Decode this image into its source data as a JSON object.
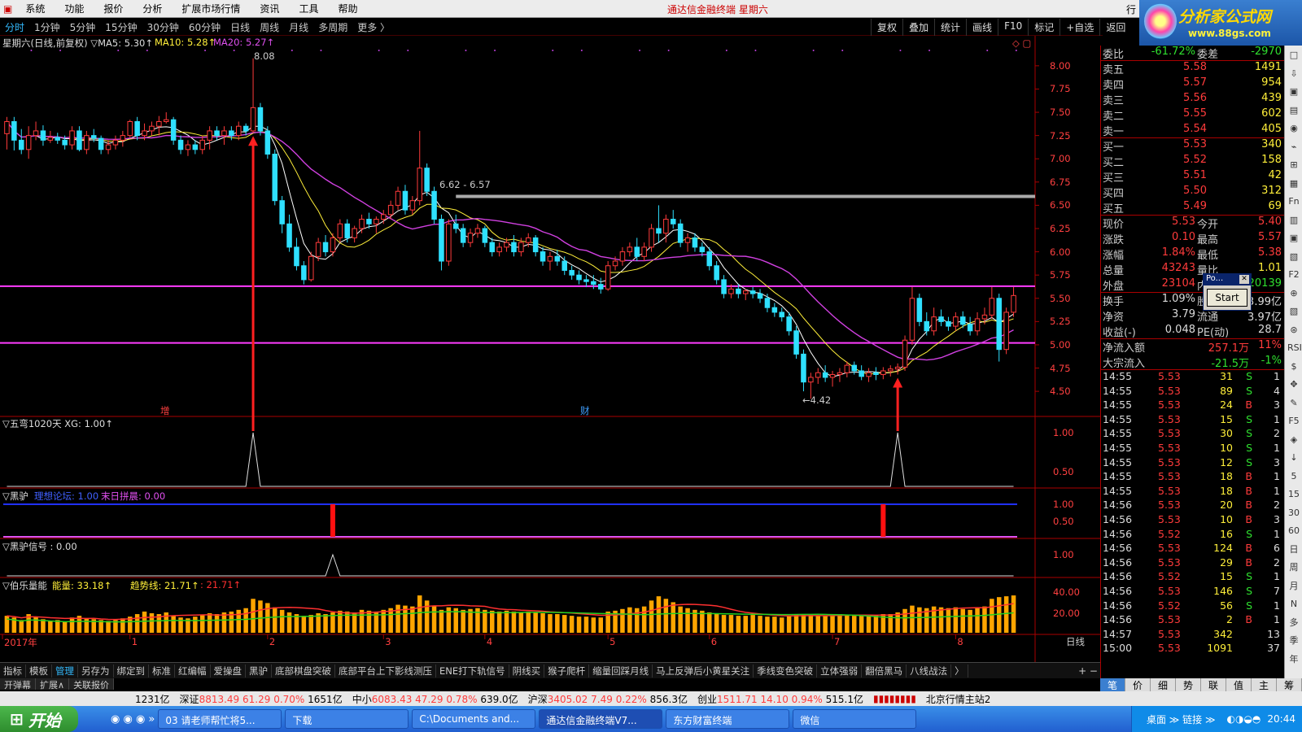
{
  "menu": [
    "系统",
    "功能",
    "报价",
    "分析",
    "扩展市场行情",
    "资讯",
    "工具",
    "帮助"
  ],
  "window_title": "通达信金融终端 星期六",
  "logo": {
    "cn": "分析家公式网",
    "url": "www.88gs.com"
  },
  "periods": [
    "分时",
    "1分钟",
    "5分钟",
    "15分钟",
    "30分钟",
    "60分钟",
    "日线",
    "周线",
    "月线",
    "多周期",
    "更多 〉"
  ],
  "active_period": "分时",
  "right_tools": [
    "复权",
    "叠加",
    "统计",
    "画线",
    "F10",
    "标记",
    "+自选",
    "返回"
  ],
  "header_right": "行",
  "main_title": "星期六(日线,前复权) ▽MA5: 5.30↑",
  "ma10": "MA10: 5.28↑",
  "ma20": "MA20: 5.27↑",
  "price_ticks": [
    "8.00",
    "7.75",
    "7.50",
    "7.25",
    "7.00",
    "6.75",
    "6.50",
    "6.25",
    "6.00",
    "5.75",
    "5.50",
    "5.25",
    "5.00",
    "4.75",
    "4.50"
  ],
  "annotations": {
    "high": "8.08",
    "box": "6.62 - 6.57",
    "low": "←4.42",
    "zeng": "增",
    "cai": "财"
  },
  "x_labels": [
    "2017年",
    "1",
    "2",
    "3",
    "4",
    "5",
    "6",
    "7",
    "8"
  ],
  "x_right": "日线",
  "panel1": {
    "title": "▽五弯1020天 XG: 1.00↑",
    "ticks": [
      "1.00",
      "0.50"
    ]
  },
  "panel2": {
    "title": "▽黑驴",
    "t2": "理想论坛: 1.00",
    "t3": "末日拼晨: 0.00",
    "ticks": [
      "1.00",
      "0.50"
    ]
  },
  "panel3": {
    "title": "▽黑驴信号 : 0.00",
    "ticks": [
      "1.00"
    ]
  },
  "panel4": {
    "title": "▽伯乐量能",
    "t2": "能量: 33.18↑",
    "t3": "趋势线: 21.71↑",
    "t4": ": 21.71↑",
    "ticks": [
      "40.00",
      "20.00"
    ]
  },
  "indicators": [
    "指标",
    "模板",
    "管理",
    "另存为",
    "绑定到",
    "标准",
    "红编幅",
    "爱操盘",
    "黑驴",
    "底部棋盘突破",
    "底部平台上下影线测压",
    "ENE打下轨信号",
    "阴线买",
    "猴子爬杆",
    "缩量回踩月线",
    "马上反弹后小黄星关注",
    "季线变色突破",
    "立体强弱",
    "翻倍黑马",
    "八线战法",
    "〉"
  ],
  "active_indicator": "管理",
  "extra_tabs": [
    "开弹幕",
    "扩展∧",
    "关联报价"
  ],
  "side": {
    "weibi": {
      "n": "委比",
      "p": "-61.72%",
      "n2": "委差",
      "v": "-2970"
    },
    "asks": [
      [
        "卖五",
        "5.58",
        "1491"
      ],
      [
        "卖四",
        "5.57",
        "954"
      ],
      [
        "卖三",
        "5.56",
        "439"
      ],
      [
        "卖二",
        "5.55",
        "602"
      ],
      [
        "卖一",
        "5.54",
        "405"
      ]
    ],
    "bids": [
      [
        "买一",
        "5.53",
        "340"
      ],
      [
        "买二",
        "5.52",
        "158"
      ],
      [
        "买三",
        "5.51",
        "42"
      ],
      [
        "买四",
        "5.50",
        "312"
      ],
      [
        "买五",
        "5.49",
        "69"
      ]
    ],
    "stats": [
      [
        "现价",
        "5.53",
        "今开",
        "5.40"
      ],
      [
        "涨跌",
        "0.10",
        "最高",
        "5.57"
      ],
      [
        "涨幅",
        "1.84%",
        "最低",
        "5.38"
      ],
      [
        "总量",
        "43243",
        "量比",
        "1.01"
      ],
      [
        "外盘",
        "23104",
        "内盘",
        "20139"
      ]
    ],
    "stats2": [
      [
        "换手",
        "1.09%",
        "股本",
        "3.99亿"
      ],
      [
        "净资",
        "3.79",
        "流通",
        "3.97亿"
      ],
      [
        "收益(-)",
        "0.048",
        "PE(动)",
        "28.7"
      ]
    ],
    "flow": [
      [
        "净流入额",
        "257.1万",
        "11%"
      ],
      [
        "大宗流入",
        "-21.5万",
        "-1%"
      ]
    ],
    "ticks": [
      [
        "14:55",
        "5.53",
        "31",
        "S",
        "1"
      ],
      [
        "14:55",
        "5.53",
        "89",
        "S",
        "4"
      ],
      [
        "14:55",
        "5.53",
        "24",
        "B",
        "3"
      ],
      [
        "14:55",
        "5.53",
        "15",
        "S",
        "1"
      ],
      [
        "14:55",
        "5.53",
        "30",
        "S",
        "2"
      ],
      [
        "14:55",
        "5.53",
        "10",
        "S",
        "1"
      ],
      [
        "14:55",
        "5.53",
        "12",
        "S",
        "3"
      ],
      [
        "14:55",
        "5.53",
        "18",
        "B",
        "1"
      ],
      [
        "14:55",
        "5.53",
        "18",
        "B",
        "1"
      ],
      [
        "14:56",
        "5.53",
        "20",
        "B",
        "2"
      ],
      [
        "14:56",
        "5.53",
        "10",
        "B",
        "3"
      ],
      [
        "14:56",
        "5.52",
        "16",
        "S",
        "1"
      ],
      [
        "14:56",
        "5.53",
        "124",
        "B",
        "6"
      ],
      [
        "14:56",
        "5.53",
        "29",
        "B",
        "2"
      ],
      [
        "14:56",
        "5.52",
        "15",
        "S",
        "1"
      ],
      [
        "14:56",
        "5.53",
        "146",
        "S",
        "7"
      ],
      [
        "14:56",
        "5.52",
        "56",
        "S",
        "1"
      ],
      [
        "14:56",
        "5.53",
        "2",
        "B",
        "1"
      ],
      [
        "14:57",
        "5.53",
        "342",
        "",
        "13"
      ],
      [
        "15:00",
        "5.53",
        "1091",
        "",
        "37"
      ]
    ]
  },
  "side_tabs": [
    "笔",
    "价",
    "细",
    "势",
    "联",
    "值",
    "主",
    "筹"
  ],
  "active_side_tab": "笔",
  "vtools": [
    "□",
    "⇩",
    "▣",
    "▤",
    "◉",
    "⌁",
    "⊞",
    "▦",
    "Fn",
    "▥",
    "▣",
    "▧",
    "F2",
    "⊕",
    "▧",
    "⊛",
    "RSI",
    "$",
    "✥",
    "✎",
    "F5",
    "◈",
    "↓",
    "5",
    "15",
    "30",
    "60",
    "日",
    "周",
    "月",
    "N",
    "多",
    "季",
    "年"
  ],
  "status": {
    "s1": "1231亿",
    "szname": "深证",
    "szv": "8813.49",
    "szc": "61.29",
    "szp": "0.70%",
    "szvol": "1651亿",
    "zxname": "中小",
    "zxv": "6083.43",
    "zxc": "47.29",
    "zxp": "0.78%",
    "zxvol": "639.0亿",
    "hsname": "沪深",
    "hsv": "3405.02",
    "hsc": "7.49",
    "hsp": "0.22%",
    "hsvol": "856.3亿",
    "cyname": "创业",
    "cyv": "1511.71",
    "cyc": "14.10",
    "cyp": "0.94%",
    "cyvol": "515.1亿",
    "server": "北京行情主站2"
  },
  "taskbar": {
    "start": "开始",
    "items": [
      "03 请老师帮忙将5...",
      "下载",
      "C:\\Documents and...",
      "通达信金融终端V7...",
      "东方财富终端",
      "微信"
    ],
    "active": "通达信金融终端V7...",
    "tray": "桌面 ≫ 链接 ≫",
    "time": "20:44"
  },
  "popup": {
    "title": "Po...",
    "button": "Start"
  },
  "colors": {
    "up": "#ff3b3b",
    "down": "#2fe0ff",
    "ma5": "#ffffff",
    "ma10": "#ffef3a",
    "ma20": "#d040e0",
    "hline": "#ff3cff",
    "box": "#aaaaaa",
    "arrow": "#ff2020",
    "vol": "#ffa500",
    "energy": "#ff3030",
    "trend": "#20d020"
  },
  "chart_data": {
    "type": "candlestick",
    "title": "星期六(日线,前复权)",
    "ylim": [
      4.3,
      8.2
    ],
    "x_months": [
      "2017年",
      "1",
      "2",
      "3",
      "4",
      "5",
      "6",
      "7",
      "8"
    ],
    "month_start_index": [
      0,
      17,
      36,
      52,
      66,
      83,
      97,
      114,
      131
    ],
    "annotations": {
      "high": 8.08,
      "low": 4.42,
      "box": [
        6.62,
        6.57
      ],
      "hlines": [
        5.63,
        5.02
      ]
    },
    "candles": [
      [
        7.27,
        7.45,
        7.1,
        7.4
      ],
      [
        7.4,
        7.45,
        7.09,
        7.2
      ],
      [
        7.2,
        7.32,
        7.05,
        7.1
      ],
      [
        7.1,
        7.35,
        7.0,
        7.25
      ],
      [
        7.25,
        7.4,
        7.2,
        7.3
      ],
      [
        7.3,
        7.36,
        7.14,
        7.2
      ],
      [
        7.2,
        7.3,
        7.17,
        7.23
      ],
      [
        7.23,
        7.28,
        7.16,
        7.2
      ],
      [
        7.2,
        7.25,
        7.1,
        7.15
      ],
      [
        7.15,
        7.35,
        7.1,
        7.3
      ],
      [
        7.3,
        7.35,
        7.08,
        7.1
      ],
      [
        7.1,
        7.3,
        7.05,
        7.25
      ],
      [
        7.25,
        7.32,
        7.18,
        7.22
      ],
      [
        7.22,
        7.25,
        7.05,
        7.1
      ],
      [
        7.1,
        7.2,
        7.05,
        7.15
      ],
      [
        7.15,
        7.25,
        7.1,
        7.2
      ],
      [
        7.2,
        7.3,
        7.13,
        7.25
      ],
      [
        7.25,
        7.42,
        7.23,
        7.4
      ],
      [
        7.4,
        7.45,
        7.2,
        7.25
      ],
      [
        7.25,
        7.38,
        7.2,
        7.3
      ],
      [
        7.3,
        7.4,
        7.25,
        7.35
      ],
      [
        7.35,
        7.46,
        7.25,
        7.4
      ],
      [
        7.4,
        7.5,
        7.38,
        7.42
      ],
      [
        7.42,
        7.45,
        7.15,
        7.2
      ],
      [
        7.2,
        7.25,
        7.05,
        7.1
      ],
      [
        7.1,
        7.2,
        7.03,
        7.15
      ],
      [
        7.15,
        7.2,
        7.05,
        7.1
      ],
      [
        7.1,
        7.25,
        7.05,
        7.2
      ],
      [
        7.2,
        7.35,
        7.1,
        7.3
      ],
      [
        7.3,
        7.35,
        7.2,
        7.25
      ],
      [
        7.25,
        7.35,
        7.15,
        7.3
      ],
      [
        7.3,
        7.35,
        7.2,
        7.25
      ],
      [
        7.25,
        7.4,
        7.2,
        7.35
      ],
      [
        7.35,
        7.38,
        7.25,
        7.3
      ],
      [
        7.3,
        8.08,
        7.28,
        7.55
      ],
      [
        7.55,
        7.6,
        7.25,
        7.3
      ],
      [
        7.3,
        7.35,
        7.0,
        7.05
      ],
      [
        7.05,
        7.1,
        6.5,
        6.55
      ],
      [
        6.55,
        6.6,
        6.2,
        6.3
      ],
      [
        6.3,
        6.4,
        6.0,
        6.05
      ],
      [
        6.05,
        6.15,
        5.8,
        5.85
      ],
      [
        5.85,
        5.9,
        5.65,
        5.7
      ],
      [
        5.7,
        6.0,
        5.68,
        5.95
      ],
      [
        5.95,
        6.15,
        5.9,
        6.1
      ],
      [
        6.1,
        6.18,
        5.95,
        6.0
      ],
      [
        6.0,
        6.2,
        5.95,
        6.15
      ],
      [
        6.15,
        6.35,
        6.1,
        6.3
      ],
      [
        6.3,
        6.35,
        6.1,
        6.15
      ],
      [
        6.15,
        6.28,
        6.1,
        6.25
      ],
      [
        6.25,
        6.4,
        6.2,
        6.35
      ],
      [
        6.35,
        6.42,
        6.25,
        6.3
      ],
      [
        6.3,
        6.38,
        6.2,
        6.35
      ],
      [
        6.35,
        6.45,
        6.3,
        6.4
      ],
      [
        6.4,
        6.55,
        6.35,
        6.5
      ],
      [
        6.5,
        6.7,
        6.45,
        6.65
      ],
      [
        6.65,
        6.72,
        6.4,
        6.45
      ],
      [
        6.45,
        6.6,
        6.4,
        6.55
      ],
      [
        6.55,
        7.3,
        6.5,
        6.9
      ],
      [
        6.9,
        6.95,
        6.6,
        6.65
      ],
      [
        6.65,
        6.7,
        6.3,
        6.35
      ],
      [
        6.35,
        6.4,
        5.8,
        5.9
      ],
      [
        5.9,
        6.35,
        5.85,
        6.3
      ],
      [
        6.3,
        6.4,
        6.2,
        6.25
      ],
      [
        6.25,
        6.3,
        6.05,
        6.1
      ],
      [
        6.1,
        6.25,
        6.05,
        6.2
      ],
      [
        6.2,
        6.3,
        6.15,
        6.25
      ],
      [
        6.25,
        6.28,
        6.05,
        6.1
      ],
      [
        6.1,
        6.15,
        5.95,
        6.0
      ],
      [
        6.0,
        6.1,
        5.95,
        6.05
      ],
      [
        6.05,
        6.15,
        6.0,
        6.1
      ],
      [
        6.1,
        6.18,
        5.95,
        6.0
      ],
      [
        6.0,
        6.15,
        5.95,
        6.1
      ],
      [
        6.1,
        6.2,
        6.05,
        6.15
      ],
      [
        6.15,
        6.18,
        5.95,
        6.0
      ],
      [
        6.0,
        6.05,
        5.85,
        5.9
      ],
      [
        5.9,
        6.0,
        5.8,
        5.95
      ],
      [
        5.95,
        6.02,
        5.85,
        5.9
      ],
      [
        5.9,
        5.95,
        5.75,
        5.8
      ],
      [
        5.8,
        5.85,
        5.7,
        5.75
      ],
      [
        5.75,
        5.8,
        5.65,
        5.7
      ],
      [
        5.7,
        5.75,
        5.62,
        5.68
      ],
      [
        5.68,
        5.75,
        5.6,
        5.65
      ],
      [
        5.65,
        5.72,
        5.55,
        5.6
      ],
      [
        5.6,
        5.9,
        5.58,
        5.85
      ],
      [
        5.85,
        5.95,
        5.8,
        5.9
      ],
      [
        5.9,
        6.05,
        5.85,
        6.0
      ],
      [
        6.0,
        6.1,
        5.95,
        6.05
      ],
      [
        6.05,
        6.15,
        5.9,
        5.95
      ],
      [
        5.95,
        6.1,
        5.9,
        6.05
      ],
      [
        6.05,
        6.3,
        6.0,
        6.25
      ],
      [
        6.25,
        6.5,
        6.1,
        6.2
      ],
      [
        6.2,
        6.4,
        6.1,
        6.35
      ],
      [
        6.35,
        6.45,
        6.25,
        6.3
      ],
      [
        6.3,
        6.35,
        6.05,
        6.1
      ],
      [
        6.1,
        6.2,
        6.0,
        6.15
      ],
      [
        6.15,
        6.2,
        6.0,
        6.05
      ],
      [
        6.05,
        6.1,
        5.95,
        6.0
      ],
      [
        6.0,
        6.05,
        5.8,
        5.85
      ],
      [
        5.85,
        5.9,
        5.65,
        5.7
      ],
      [
        5.7,
        5.75,
        5.5,
        5.55
      ],
      [
        5.55,
        5.65,
        5.5,
        5.6
      ],
      [
        5.6,
        5.65,
        5.5,
        5.55
      ],
      [
        5.55,
        5.6,
        5.48,
        5.58
      ],
      [
        5.58,
        5.62,
        5.5,
        5.55
      ],
      [
        5.55,
        5.6,
        5.45,
        5.5
      ],
      [
        5.5,
        5.55,
        5.35,
        5.4
      ],
      [
        5.4,
        5.45,
        5.3,
        5.35
      ],
      [
        5.35,
        5.4,
        5.25,
        5.3
      ],
      [
        5.3,
        5.35,
        5.1,
        5.15
      ],
      [
        5.15,
        5.2,
        4.85,
        4.9
      ],
      [
        4.9,
        4.95,
        4.5,
        4.6
      ],
      [
        4.6,
        4.7,
        4.42,
        4.65
      ],
      [
        4.65,
        4.75,
        4.58,
        4.7
      ],
      [
        4.7,
        4.78,
        4.6,
        4.65
      ],
      [
        4.65,
        4.72,
        4.55,
        4.68
      ],
      [
        4.68,
        4.75,
        4.6,
        4.7
      ],
      [
        4.7,
        4.82,
        4.65,
        4.78
      ],
      [
        4.78,
        4.82,
        4.68,
        4.72
      ],
      [
        4.72,
        4.78,
        4.62,
        4.66
      ],
      [
        4.66,
        4.75,
        4.6,
        4.7
      ],
      [
        4.7,
        4.76,
        4.62,
        4.68
      ],
      [
        4.68,
        4.76,
        4.63,
        4.72
      ],
      [
        4.72,
        4.78,
        4.66,
        4.74
      ],
      [
        4.74,
        4.8,
        4.68,
        4.76
      ],
      [
        4.76,
        5.1,
        4.72,
        5.05
      ],
      [
        5.05,
        5.62,
        5.0,
        5.5
      ],
      [
        5.5,
        5.55,
        5.2,
        5.25
      ],
      [
        5.25,
        5.35,
        5.1,
        5.15
      ],
      [
        5.15,
        5.4,
        5.1,
        5.3
      ],
      [
        5.3,
        5.38,
        5.2,
        5.25
      ],
      [
        5.25,
        5.3,
        5.15,
        5.2
      ],
      [
        5.2,
        5.35,
        5.15,
        5.3
      ],
      [
        5.3,
        5.36,
        5.18,
        5.22
      ],
      [
        5.22,
        5.3,
        5.1,
        5.15
      ],
      [
        5.15,
        5.35,
        5.1,
        5.28
      ],
      [
        5.28,
        5.4,
        5.22,
        5.32
      ],
      [
        5.32,
        5.62,
        5.28,
        5.5
      ],
      [
        5.5,
        5.55,
        4.82,
        4.95
      ],
      [
        4.95,
        5.4,
        4.9,
        5.35
      ],
      [
        5.35,
        5.62,
        5.3,
        5.53
      ]
    ],
    "volume": [
      20,
      18,
      15,
      22,
      19,
      16,
      14,
      15,
      13,
      18,
      20,
      17,
      16,
      15,
      14,
      15,
      17,
      19,
      22,
      25,
      23,
      22,
      24,
      20,
      18,
      17,
      19,
      21,
      23,
      22,
      24,
      25,
      27,
      29,
      40,
      38,
      35,
      30,
      27,
      24,
      22,
      20,
      21,
      23,
      22,
      24,
      26,
      25,
      24,
      27,
      26,
      25,
      27,
      29,
      33,
      32,
      31,
      44,
      38,
      32,
      27,
      30,
      29,
      27,
      28,
      29,
      27,
      26,
      25,
      26,
      25,
      24,
      25,
      24,
      23,
      22,
      22,
      21,
      20,
      19,
      19,
      18,
      18,
      25,
      26,
      28,
      30,
      29,
      31,
      38,
      43,
      40,
      36,
      31,
      29,
      27,
      26,
      24,
      22,
      21,
      21,
      20,
      20,
      21,
      20,
      19,
      19,
      18,
      20,
      22,
      22,
      21,
      20,
      20,
      21,
      22,
      21,
      20,
      20,
      21,
      21,
      22,
      22,
      24,
      28,
      32,
      30,
      29,
      31,
      30,
      29,
      30,
      28,
      27,
      30,
      31,
      40,
      42,
      43,
      44
    ],
    "signals": {
      "wuwan_xg": [
        34,
        123,
        141
      ],
      "heilv_bars": [
        45,
        121
      ],
      "heilv_signal": [
        45
      ]
    }
  }
}
